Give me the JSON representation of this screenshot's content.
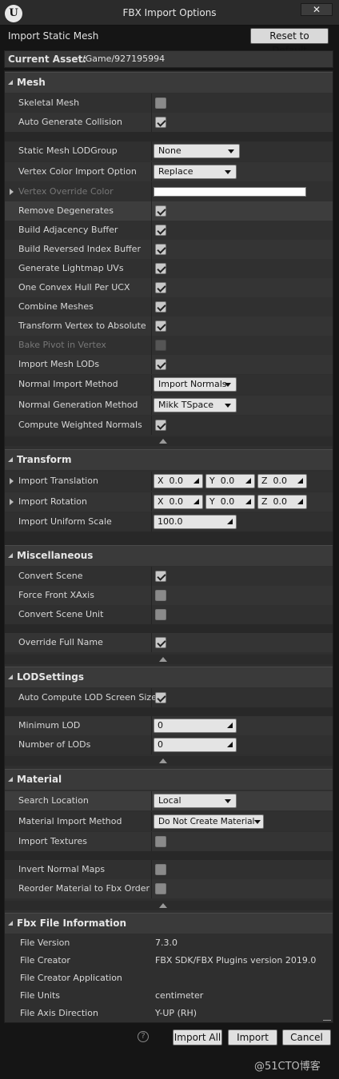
{
  "window": {
    "title": "FBX Import Options",
    "close_glyph": "✕"
  },
  "header": {
    "text": "Import Static Mesh",
    "reset_label": "Reset to Default"
  },
  "asset": {
    "label": "Current Asset:",
    "value": "/Game/927195994"
  },
  "mesh": {
    "title": "Mesh",
    "skeletal_mesh": {
      "label": "Skeletal Mesh",
      "checked": false
    },
    "auto_collision": {
      "label": "Auto Generate Collision",
      "checked": true
    },
    "lod_group": {
      "label": "Static Mesh LODGroup",
      "value": "None"
    },
    "vertex_color_import": {
      "label": "Vertex Color Import Option",
      "value": "Replace"
    },
    "vertex_override_color": {
      "label": "Vertex Override Color",
      "color": "#ffffff"
    },
    "remove_degenerates": {
      "label": "Remove Degenerates",
      "checked": true
    },
    "build_adjacency": {
      "label": "Build Adjacency Buffer",
      "checked": true
    },
    "build_reversed": {
      "label": "Build Reversed Index Buffer",
      "checked": true
    },
    "lightmap_uvs": {
      "label": "Generate Lightmap UVs",
      "checked": true
    },
    "convex_hull": {
      "label": "One Convex Hull Per UCX",
      "checked": true
    },
    "combine_meshes": {
      "label": "Combine Meshes",
      "checked": true
    },
    "transform_vertex": {
      "label": "Transform Vertex to Absolute",
      "checked": true
    },
    "bake_pivot": {
      "label": "Bake Pivot in Vertex",
      "checked": false
    },
    "import_lods": {
      "label": "Import Mesh LODs",
      "checked": true
    },
    "normal_import": {
      "label": "Normal Import Method",
      "value": "Import Normals"
    },
    "normal_generation": {
      "label": "Normal Generation Method",
      "value": "Mikk TSpace"
    },
    "weighted_normals": {
      "label": "Compute Weighted Normals",
      "checked": true
    }
  },
  "transform": {
    "title": "Transform",
    "translation": {
      "label": "Import Translation",
      "x": "0.0",
      "y": "0.0",
      "z": "0.0"
    },
    "rotation": {
      "label": "Import Rotation",
      "x": "0.0",
      "y": "0.0",
      "z": "0.0"
    },
    "scale": {
      "label": "Import Uniform Scale",
      "value": "100.0"
    },
    "axis_x": "X",
    "axis_y": "Y",
    "axis_z": "Z"
  },
  "misc": {
    "title": "Miscellaneous",
    "convert_scene": {
      "label": "Convert Scene",
      "checked": true
    },
    "force_front_x": {
      "label": "Force Front XAxis",
      "checked": false
    },
    "convert_unit": {
      "label": "Convert Scene Unit",
      "checked": false
    },
    "override_name": {
      "label": "Override Full Name",
      "checked": true
    }
  },
  "lod": {
    "title": "LODSettings",
    "auto_compute": {
      "label": "Auto Compute LOD Screen Size",
      "checked": true
    },
    "min_lod": {
      "label": "Minimum LOD",
      "value": "0"
    },
    "num_lods": {
      "label": "Number of LODs",
      "value": "0"
    }
  },
  "material": {
    "title": "Material",
    "search_location": {
      "label": "Search Location",
      "value": "Local"
    },
    "import_method": {
      "label": "Material Import Method",
      "value": "Do Not Create Material"
    },
    "import_textures": {
      "label": "Import Textures",
      "checked": false
    },
    "invert_normal": {
      "label": "Invert Normal Maps",
      "checked": false
    },
    "reorder": {
      "label": "Reorder Material to Fbx Order",
      "checked": false
    }
  },
  "fbx_info": {
    "title": "Fbx File Information",
    "rows": [
      {
        "label": "File Version",
        "value": "7.3.0"
      },
      {
        "label": "File Creator",
        "value": "FBX SDK/FBX Plugins version 2019.0"
      },
      {
        "label": "File Creator Application",
        "value": ""
      },
      {
        "label": "File Units",
        "value": "centimeter"
      },
      {
        "label": "File Axis Direction",
        "value": "Y-UP (RH)"
      }
    ]
  },
  "footer": {
    "help_glyph": "?",
    "import_all": "Import All",
    "import": "Import",
    "cancel": "Cancel"
  },
  "watermark": "@51CTO博客"
}
